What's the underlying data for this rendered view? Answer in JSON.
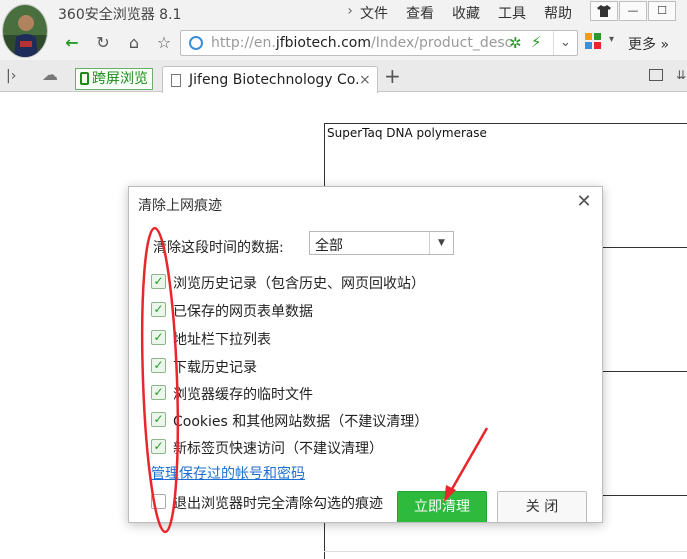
{
  "window": {
    "title": "360安全浏览器 8.1",
    "menu": [
      "文件",
      "查看",
      "收藏",
      "工具",
      "帮助"
    ]
  },
  "address_bar": {
    "url_prefix": "http://en.",
    "url_domain": "jfbiotech.com",
    "url_path": "/Index/product_desc.",
    "more_label": "更多"
  },
  "tabs": {
    "cross_screen_label": "跨屏浏览",
    "active_title": "Jifeng Biotechnology Co."
  },
  "page": {
    "product_name": "SuperTaq DNA polymerase"
  },
  "dialog": {
    "title": "清除上网痕迹",
    "range_label": "清除这段时间的数据:",
    "range_value": "全部",
    "options": [
      {
        "label": "浏览历史记录（包含历史、网页回收站）",
        "checked": true
      },
      {
        "label": "已保存的网页表单数据",
        "checked": true
      },
      {
        "label": "地址栏下拉列表",
        "checked": true
      },
      {
        "label": "下载历史记录",
        "checked": true
      },
      {
        "label": "浏览器缓存的临时文件",
        "checked": true
      },
      {
        "label": "Cookies 和其他网站数据（不建议清理）",
        "checked": true
      },
      {
        "label": "新标签页快速访问（不建议清理）",
        "checked": true
      }
    ],
    "manage_link": "管理保存过的帐号和密码",
    "exit_option": {
      "label": "退出浏览器时完全清除勾选的痕迹",
      "checked": false
    },
    "clear_button": "立即清理",
    "close_button": "关 闭"
  },
  "colors": {
    "accent_green": "#2dba3d",
    "link_blue": "#1d6fcf",
    "annotation_red": "#e8262b"
  }
}
